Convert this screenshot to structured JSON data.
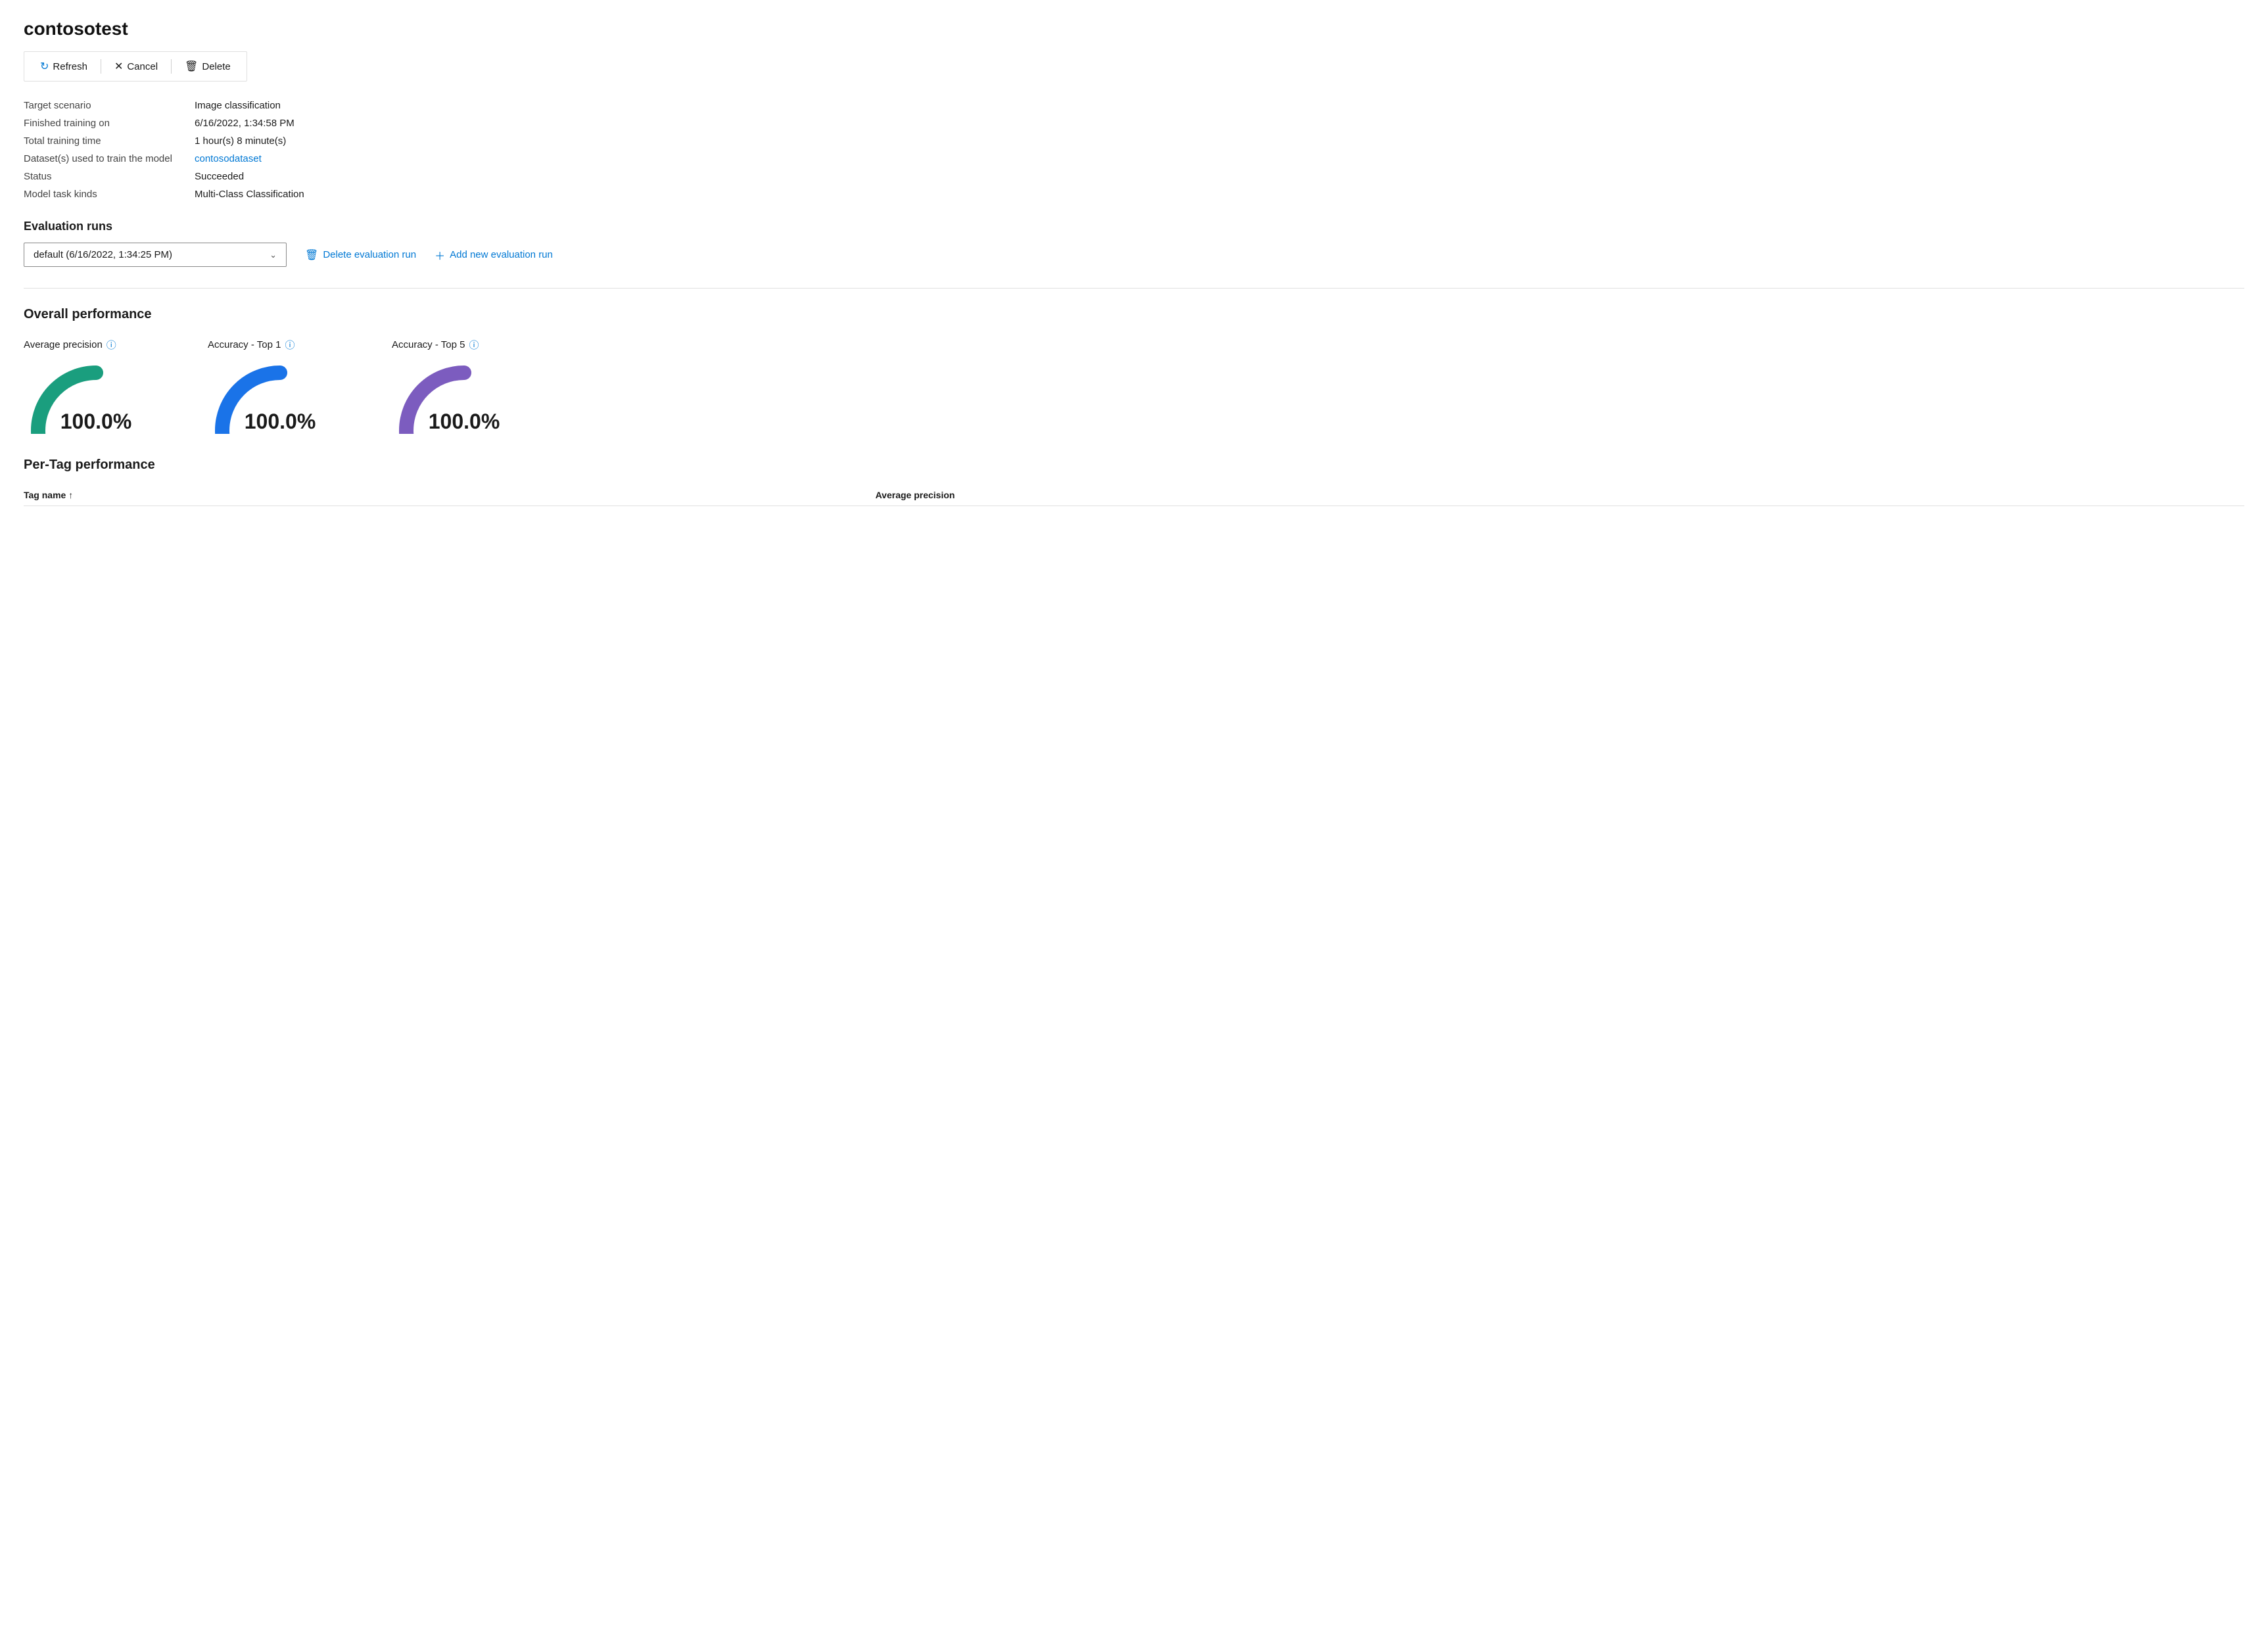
{
  "page": {
    "title": "contosotest"
  },
  "toolbar": {
    "refresh_label": "Refresh",
    "cancel_label": "Cancel",
    "delete_label": "Delete"
  },
  "info": {
    "fields": [
      {
        "label": "Target scenario",
        "value": "Image classification",
        "type": "text"
      },
      {
        "label": "Finished training on",
        "value": "6/16/2022, 1:34:58 PM",
        "type": "text"
      },
      {
        "label": "Total training time",
        "value": "1 hour(s) 8 minute(s)",
        "type": "text"
      },
      {
        "label": "Dataset(s) used to train the model",
        "value": "contosodataset",
        "type": "link"
      },
      {
        "label": "Status",
        "value": "Succeeded",
        "type": "text"
      },
      {
        "label": "Model task kinds",
        "value": "Multi-Class Classification",
        "type": "text"
      }
    ]
  },
  "evaluation_runs": {
    "section_title": "Evaluation runs",
    "dropdown_value": "default (6/16/2022, 1:34:25 PM)",
    "delete_label": "Delete evaluation run",
    "add_label": "Add new evaluation run"
  },
  "overall_performance": {
    "section_title": "Overall performance",
    "gauges": [
      {
        "label": "Average precision",
        "value": "100.0%",
        "color": "#1a9e7e"
      },
      {
        "label": "Accuracy - Top 1",
        "value": "100.0%",
        "color": "#1a73e8"
      },
      {
        "label": "Accuracy - Top 5",
        "value": "100.0%",
        "color": "#7c5cbf"
      }
    ]
  },
  "per_tag": {
    "section_title": "Per-Tag performance",
    "columns": [
      {
        "label": "Tag name",
        "sortable": true
      },
      {
        "label": "Average precision",
        "sortable": false
      }
    ]
  }
}
